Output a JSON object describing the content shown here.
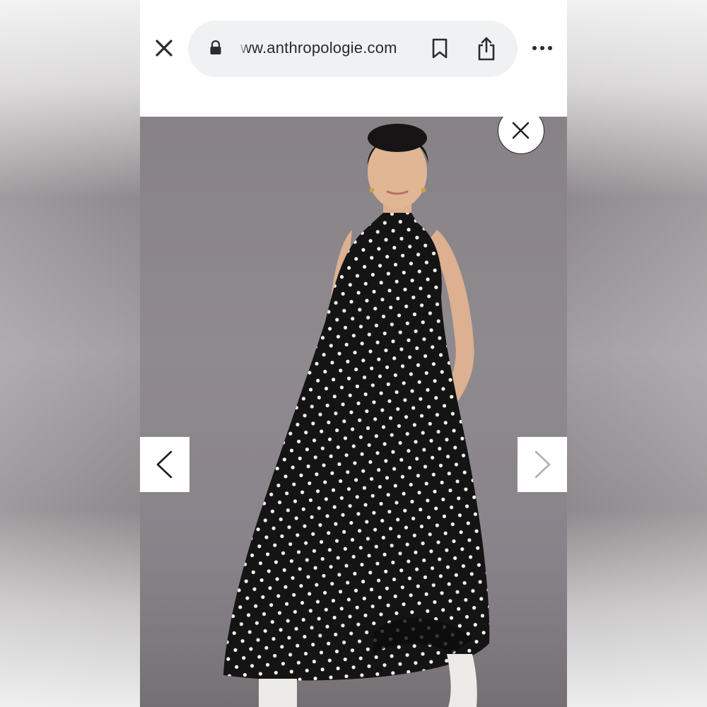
{
  "browser": {
    "url": "ww.anthropologie.com",
    "icons": {
      "close": "close-icon",
      "lock": "lock-icon",
      "bookmark": "bookmark-icon",
      "share": "share-icon",
      "more": "more-options-icon"
    }
  },
  "viewer": {
    "close": "close-modal-icon",
    "prev": "chevron-left-icon",
    "next": "chevron-right-icon",
    "image_subject": "model-in-black-polka-dot-dress",
    "colors": {
      "backdrop": "#8a8589",
      "dress": "#141414",
      "dots": "#f4f1ea",
      "skin": "#e0b695"
    }
  }
}
